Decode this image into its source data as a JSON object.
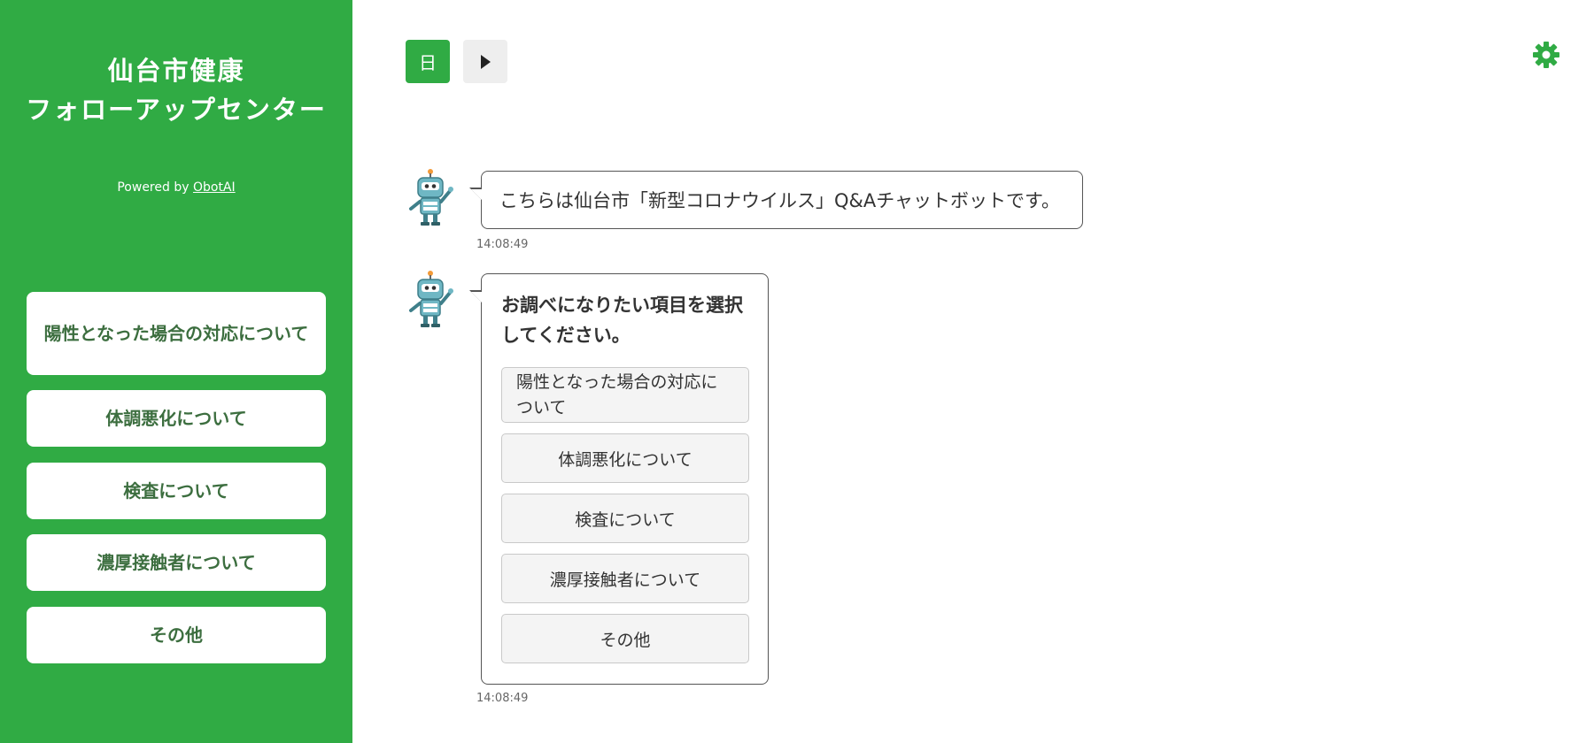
{
  "sidebar": {
    "title_line1": "仙台市健康",
    "title_line2": "フォローアップセンター",
    "powered_prefix": "Powered by",
    "powered_link": "ObotAI",
    "items": [
      {
        "label": "陽性となった場合の対応について"
      },
      {
        "label": "体調悪化について"
      },
      {
        "label": "検査について"
      },
      {
        "label": "濃厚接触者について"
      },
      {
        "label": "その他"
      }
    ]
  },
  "toolbar": {
    "language_label": "日",
    "play_icon": "play-icon",
    "settings_icon": "gear-icon"
  },
  "chat": {
    "messages": [
      {
        "text": "こちらは仙台市「新型コロナウイルス」Q&Aチャットボットです。",
        "time": "14:08:49"
      },
      {
        "text": "お調べになりたい項目を選択してください。",
        "time": "14:08:49",
        "options": [
          {
            "label": "陽性となった場合の対応について"
          },
          {
            "label": "体調悪化について"
          },
          {
            "label": "検査について"
          },
          {
            "label": "濃厚接触者について"
          },
          {
            "label": "その他"
          }
        ]
      }
    ]
  },
  "colors": {
    "brand_green": "#30ab44",
    "sidebar_button_text": "#3c6e3f"
  }
}
